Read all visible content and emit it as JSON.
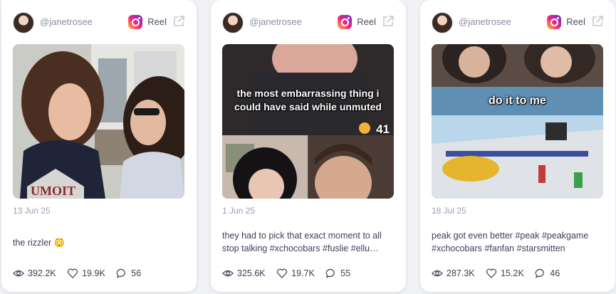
{
  "cards": [
    {
      "handle": "@janetrosee",
      "type": "Reel",
      "date": "13 Jun 25",
      "caption": "the rizzler 😳",
      "views": "392.2K",
      "likes": "19.9K",
      "comments": "56",
      "overlay_text": "",
      "overlay_count": ""
    },
    {
      "handle": "@janetrosee",
      "type": "Reel",
      "date": "1 Jun 25",
      "caption": "they had to pick that exact moment to all stop talking #xchocobars #fuslie #ellu…",
      "views": "325.6K",
      "likes": "19.7K",
      "comments": "55",
      "overlay_text": "the most embarrassing thing i could have said while unmuted",
      "overlay_count": "41"
    },
    {
      "handle": "@janetrosee",
      "type": "Reel",
      "date": "18 Jul 25",
      "caption": "peak got even better #peak #peakgame #xchocobars #fanfan #starsmitten",
      "views": "287.3K",
      "likes": "15.2K",
      "comments": "46",
      "overlay_text": "do it to me",
      "overlay_count": ""
    }
  ],
  "icons": {
    "platform": "instagram-icon",
    "external": "external-link-icon",
    "views": "eye-icon",
    "likes": "heart-icon",
    "comments": "comment-icon"
  },
  "colors": {
    "background": "#f1f2f6",
    "card": "#ffffff",
    "muted_text": "#9a9eb0",
    "body_text": "#3d4154"
  }
}
